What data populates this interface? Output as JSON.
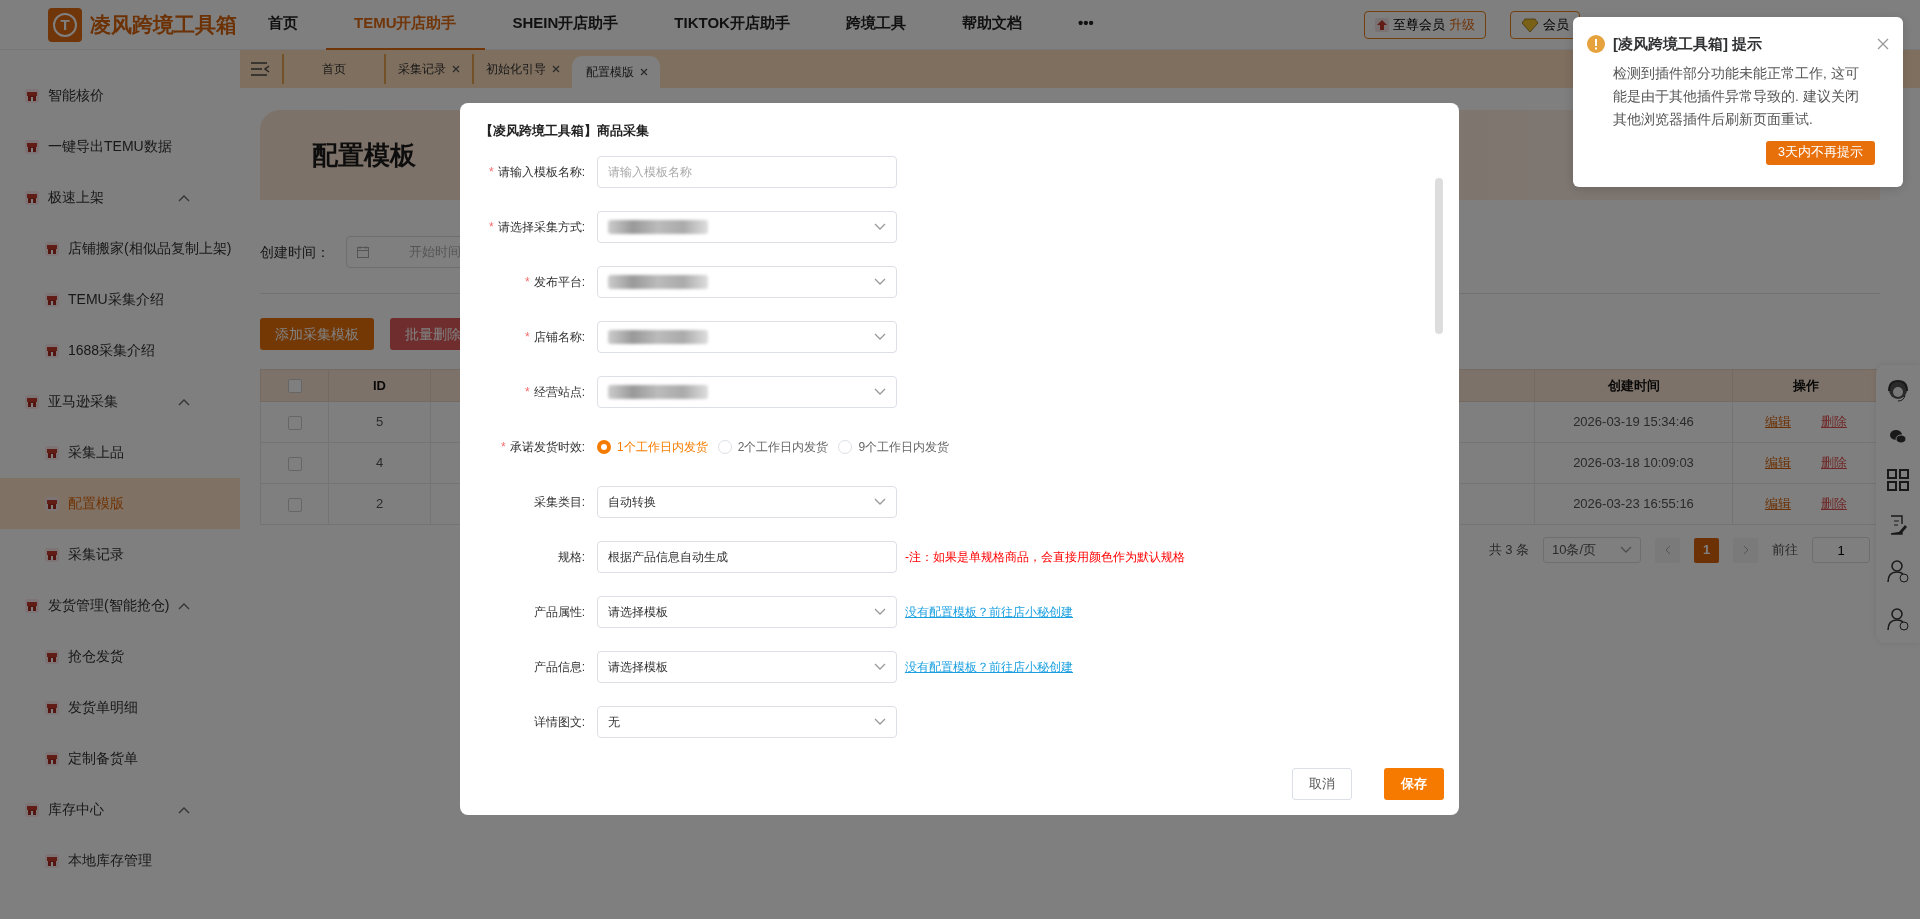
{
  "logo": {
    "mark": "T",
    "name": "凌风跨境工具箱"
  },
  "nav": [
    {
      "label": "首页",
      "selected": false
    },
    {
      "label": "TEMU开店助手",
      "selected": true
    },
    {
      "label": "SHEIN开店助手",
      "selected": false
    },
    {
      "label": "TIKTOK开店助手",
      "selected": false
    },
    {
      "label": "跨境工具",
      "selected": false
    },
    {
      "label": "帮助文档",
      "selected": false
    }
  ],
  "nav_more": "•••",
  "header_buttons": [
    {
      "label": "至尊会员",
      "accent": "升级",
      "kind": "upgrade"
    },
    {
      "label": "会员",
      "kind": "vip"
    }
  ],
  "sidebar": {
    "items": [
      {
        "label": "智能核价",
        "selected": false
      },
      {
        "label": "一键导出TEMU数据",
        "selected": false
      },
      {
        "label": "极速上架",
        "selected": false,
        "expanded": true,
        "children": [
          {
            "label": "店铺搬家(相似品复制上架)",
            "selected": false
          },
          {
            "label": "TEMU采集介绍",
            "selected": false
          },
          {
            "label": "1688采集介绍",
            "selected": false
          }
        ]
      },
      {
        "label": "亚马逊采集",
        "selected": false,
        "expanded": true,
        "children": [
          {
            "label": "采集上品",
            "selected": false
          },
          {
            "label": "配置模版",
            "selected": true
          },
          {
            "label": "采集记录",
            "selected": false
          }
        ]
      },
      {
        "label": "发货管理(智能抢仓)",
        "selected": false,
        "expanded": true,
        "children": [
          {
            "label": "抢仓发货",
            "selected": false
          },
          {
            "label": "发货单明细",
            "selected": false
          },
          {
            "label": "定制备货单",
            "selected": false
          }
        ]
      },
      {
        "label": "库存中心",
        "selected": false,
        "expanded": true,
        "children": [
          {
            "label": "本地库存管理",
            "selected": false
          }
        ]
      }
    ]
  },
  "tabs": [
    {
      "label": "首页",
      "closable": false,
      "selected": false
    },
    {
      "label": "采集记录",
      "closable": true,
      "selected": false
    },
    {
      "label": "初始化引导",
      "closable": true,
      "selected": false
    },
    {
      "label": "配置模版",
      "closable": true,
      "selected": true
    }
  ],
  "page_title": "配置模板",
  "filter": {
    "label": "创建时间：",
    "placeholder": "开始时间"
  },
  "actions": [
    {
      "label": "添加采集模板",
      "kind": "primary"
    },
    {
      "label": "批量删除",
      "kind": "danger"
    }
  ],
  "table": {
    "select_all_checked": false,
    "columns": [
      "ID",
      "创建时间",
      "操作"
    ],
    "rows": [
      {
        "checked": false,
        "id": "5",
        "created": "2026-03-19 15:34:46",
        "edit": "编辑",
        "delete": "删除"
      },
      {
        "checked": false,
        "id": "4",
        "created": "2026-03-18 10:09:03",
        "edit": "编辑",
        "delete": "删除"
      },
      {
        "checked": false,
        "id": "2",
        "created": "2026-03-23 16:55:16",
        "edit": "编辑",
        "delete": "删除"
      }
    ]
  },
  "pagination": {
    "total": "共 3 条",
    "page_size": "10条/页",
    "pages": [
      {
        "label": "1",
        "selected": true
      }
    ],
    "goto": "前往",
    "goto_value": "1"
  },
  "modal": {
    "title": "【凌风跨境工具箱】商品采集",
    "fields": [
      {
        "label": "请输入模板名称:",
        "required_mark": "*",
        "kind": "text",
        "placeholder": "请输入模板名称"
      },
      {
        "label": "请选择采集方式:",
        "required_mark": "*",
        "kind": "select",
        "redacted": true
      },
      {
        "label": "发布平台:",
        "required_mark": "*",
        "kind": "select",
        "redacted": true
      },
      {
        "label": "店铺名称:",
        "required_mark": "*",
        "kind": "select",
        "redacted": true
      },
      {
        "label": "经营站点:",
        "required_mark": "*",
        "kind": "select",
        "redacted": true
      },
      {
        "label": "承诺发货时效:",
        "required_mark": "*",
        "kind": "radio",
        "options": [
          {
            "label": "1个工作日内发货",
            "selected": true
          },
          {
            "label": "2个工作日内发货",
            "selected": false
          },
          {
            "label": "9个工作日内发货",
            "selected": false
          }
        ]
      },
      {
        "label": "采集类目:",
        "kind": "select",
        "value": "自动转换"
      },
      {
        "label": "规格:",
        "kind": "text",
        "value": "根据产品信息自动生成",
        "hint": {
          "kind": "warning",
          "text": "-注：如果是单规格商品，会直接用颜色作为默认规格"
        }
      },
      {
        "label": "产品属性:",
        "kind": "select",
        "value": "请选择模板",
        "hint": {
          "kind": "link",
          "text": "没有配置模板？前往店小秘创建"
        }
      },
      {
        "label": "产品信息:",
        "kind": "select",
        "value": "请选择模板",
        "hint": {
          "kind": "link",
          "text": "没有配置模板？前往店小秘创建"
        }
      },
      {
        "label": "详情图文:",
        "kind": "select",
        "value": "无"
      }
    ],
    "buttons": [
      {
        "label": "取消",
        "kind": "secondary"
      },
      {
        "label": "保存",
        "kind": "primary"
      }
    ]
  },
  "notification": {
    "title": "[凌风跨境工具箱] 提示",
    "message": "检测到插件部分功能未能正常工作, 这可能是由于其他插件异常导致的. 建议关闭其他浏览器插件后刷新页面重试.",
    "button": "3天内不再提示"
  }
}
